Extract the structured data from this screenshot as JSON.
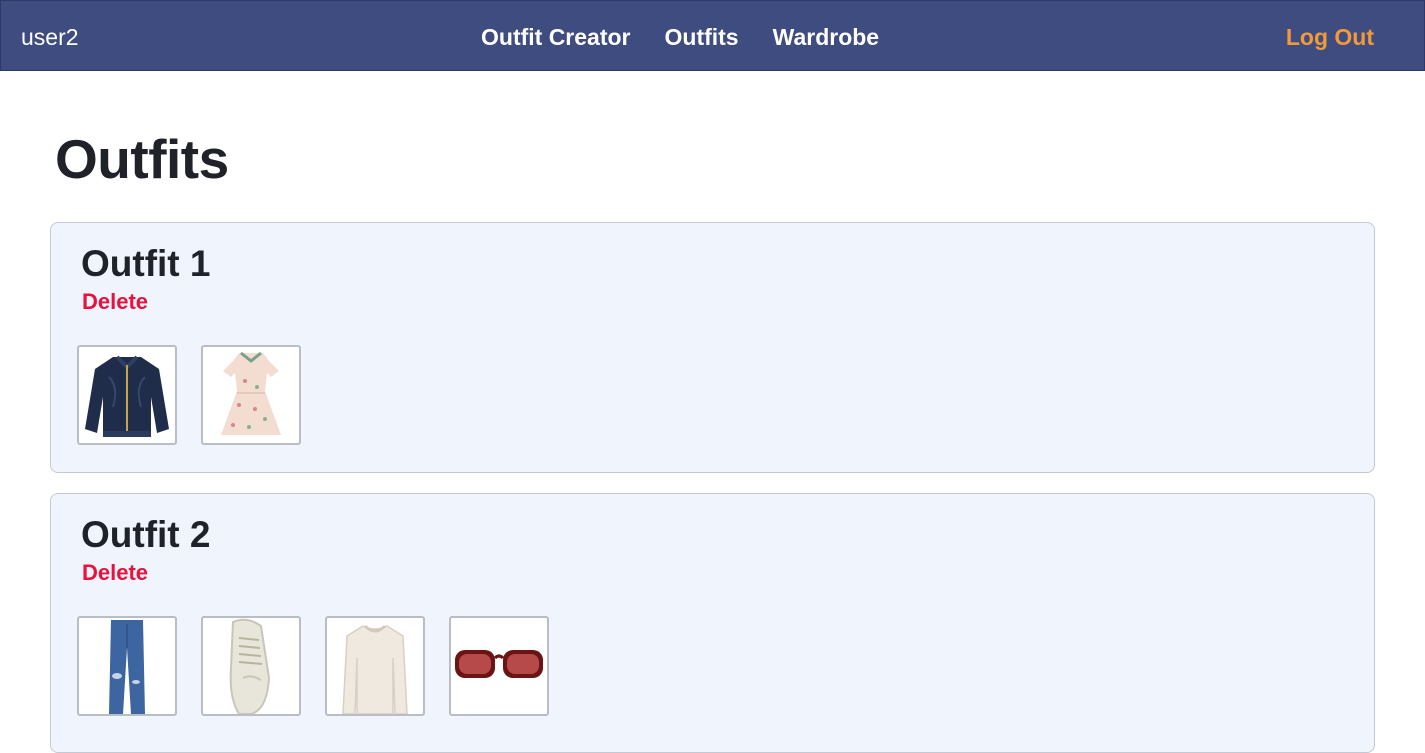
{
  "nav": {
    "user": "user2",
    "links": [
      "Outfit Creator",
      "Outfits",
      "Wardrobe"
    ],
    "logout": "Log Out"
  },
  "page": {
    "title": "Outfits"
  },
  "outfits": [
    {
      "title": "Outfit 1",
      "delete_label": "Delete",
      "items": [
        "navy-bomber-jacket",
        "floral-dress"
      ]
    },
    {
      "title": "Outfit 2",
      "delete_label": "Delete",
      "items": [
        "blue-ripped-jeans",
        "white-sneaker",
        "cream-sweater",
        "red-sunglasses"
      ]
    }
  ],
  "colors": {
    "navbar": "#3f4c80",
    "logout": "#f29a3a",
    "delete": "#e8123c",
    "card_bg": "#f0f4fd"
  }
}
